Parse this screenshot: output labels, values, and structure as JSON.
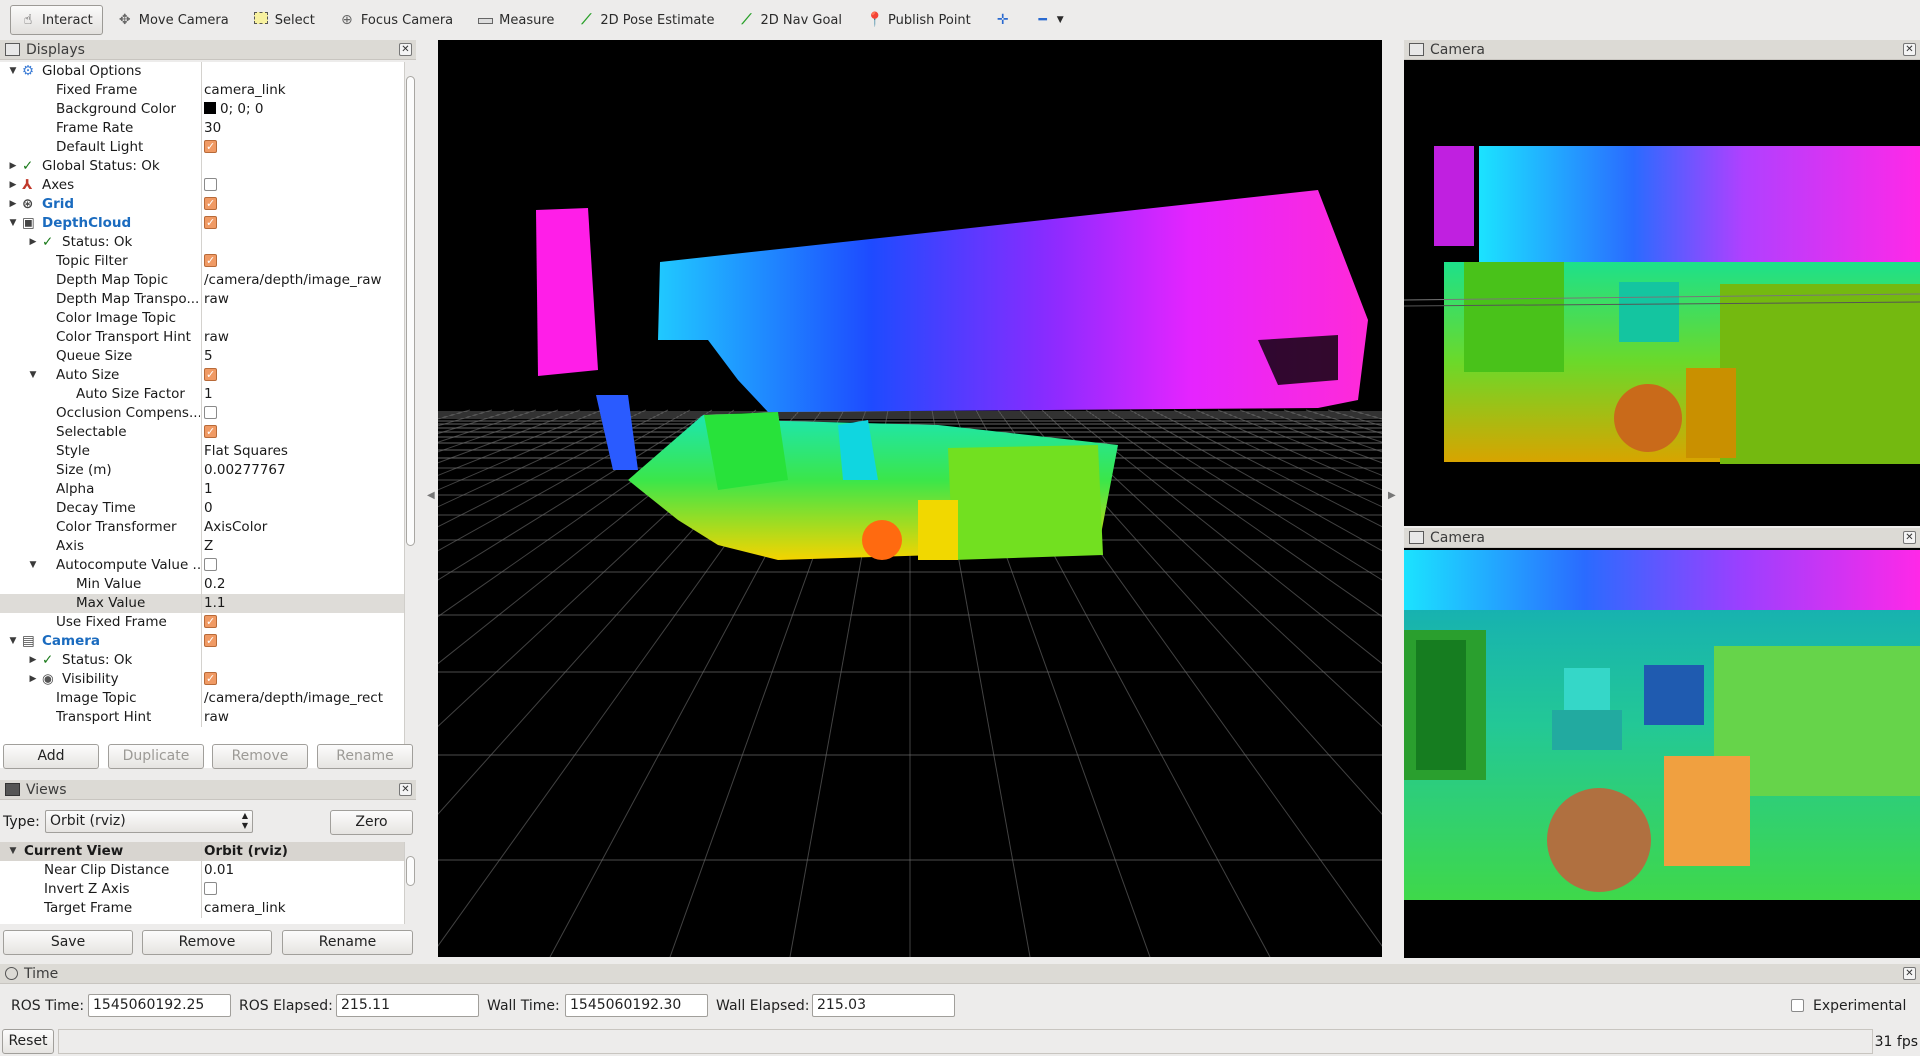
{
  "toolbar": {
    "tools": [
      {
        "label": "Interact",
        "icon": "cursor-icon"
      },
      {
        "label": "Move Camera",
        "icon": "move-icon"
      },
      {
        "label": "Select",
        "icon": "select-box-icon"
      },
      {
        "label": "Focus Camera",
        "icon": "focus-icon"
      },
      {
        "label": "Measure",
        "icon": "ruler-icon"
      },
      {
        "label": "2D Pose Estimate",
        "icon": "pose-arrow-icon"
      },
      {
        "label": "2D Nav Goal",
        "icon": "nav-goal-icon"
      },
      {
        "label": "Publish Point",
        "icon": "map-pin-icon"
      }
    ],
    "active_tool": "Interact"
  },
  "displays": {
    "title": "Displays",
    "rows": [
      {
        "indent": 0,
        "arrow": "open",
        "icon": "gear",
        "name": "Global Options",
        "value": "",
        "style": ""
      },
      {
        "indent": 1,
        "arrow": "",
        "name": "Fixed Frame",
        "value": "camera_link"
      },
      {
        "indent": 1,
        "arrow": "",
        "name": "Background Color",
        "value": "0; 0; 0",
        "swatch": "#000000"
      },
      {
        "indent": 1,
        "arrow": "",
        "name": "Frame Rate",
        "value": "30"
      },
      {
        "indent": 1,
        "arrow": "",
        "name": "Default Light",
        "check": true
      },
      {
        "indent": 0,
        "arrow": "closed",
        "icon": "ok",
        "name": "Global Status: Ok",
        "value": ""
      },
      {
        "indent": 0,
        "arrow": "closed",
        "icon": "axes",
        "name": "Axes",
        "check": false
      },
      {
        "indent": 0,
        "arrow": "closed",
        "icon": "grid",
        "name": "Grid",
        "check": true,
        "style": "blue"
      },
      {
        "indent": 0,
        "arrow": "open",
        "icon": "cloud",
        "name": "DepthCloud",
        "check": true,
        "style": "blue"
      },
      {
        "indent": 1,
        "arrow": "closed",
        "icon": "ok",
        "name": "Status: Ok",
        "value": ""
      },
      {
        "indent": 1,
        "arrow": "",
        "name": "Topic Filter",
        "check": true
      },
      {
        "indent": 1,
        "arrow": "",
        "name": "Depth Map Topic",
        "value": "/camera/depth/image_raw"
      },
      {
        "indent": 1,
        "arrow": "",
        "name": "Depth Map Transpo...",
        "value": "raw"
      },
      {
        "indent": 1,
        "arrow": "",
        "name": "Color Image Topic",
        "value": ""
      },
      {
        "indent": 1,
        "arrow": "",
        "name": "Color Transport Hint",
        "value": "raw"
      },
      {
        "indent": 1,
        "arrow": "",
        "name": "Queue Size",
        "value": "5"
      },
      {
        "indent": 1,
        "arrow": "open",
        "name": "Auto Size",
        "check": true
      },
      {
        "indent": 2,
        "arrow": "",
        "name": "Auto Size Factor",
        "value": "1"
      },
      {
        "indent": 1,
        "arrow": "",
        "name": "Occlusion Compens...",
        "check": false
      },
      {
        "indent": 1,
        "arrow": "",
        "name": "Selectable",
        "check": true
      },
      {
        "indent": 1,
        "arrow": "",
        "name": "Style",
        "value": "Flat Squares"
      },
      {
        "indent": 1,
        "arrow": "",
        "name": "Size (m)",
        "value": "0.00277767"
      },
      {
        "indent": 1,
        "arrow": "",
        "name": "Alpha",
        "value": "1"
      },
      {
        "indent": 1,
        "arrow": "",
        "name": "Decay Time",
        "value": "0"
      },
      {
        "indent": 1,
        "arrow": "",
        "name": "Color Transformer",
        "value": "AxisColor"
      },
      {
        "indent": 1,
        "arrow": "",
        "name": "Axis",
        "value": "Z"
      },
      {
        "indent": 1,
        "arrow": "open",
        "name": "Autocompute Value ...",
        "check": false
      },
      {
        "indent": 2,
        "arrow": "",
        "name": "Min Value",
        "value": "0.2"
      },
      {
        "indent": 2,
        "arrow": "",
        "name": "Max Value",
        "value": "1.1",
        "selected": true
      },
      {
        "indent": 1,
        "arrow": "",
        "name": "Use Fixed Frame",
        "check": true
      },
      {
        "indent": 0,
        "arrow": "open",
        "icon": "camera",
        "name": "Camera",
        "check": true,
        "style": "blue"
      },
      {
        "indent": 1,
        "arrow": "closed",
        "icon": "ok",
        "name": "Status: Ok",
        "value": ""
      },
      {
        "indent": 1,
        "arrow": "closed",
        "icon": "eye",
        "name": "Visibility",
        "check": true
      },
      {
        "indent": 1,
        "arrow": "",
        "name": "Image Topic",
        "value": "/camera/depth/image_rect"
      },
      {
        "indent": 1,
        "arrow": "",
        "name": "Transport Hint",
        "value": "raw"
      }
    ],
    "buttons": {
      "add": "Add",
      "duplicate": "Duplicate",
      "remove": "Remove",
      "rename": "Rename"
    }
  },
  "views": {
    "title": "Views",
    "type_label": "Type:",
    "type_value": "Orbit (rviz)",
    "zero_label": "Zero",
    "header": {
      "name": "Current View",
      "value": "Orbit (rviz)"
    },
    "rows": [
      {
        "name": "Near Clip Distance",
        "value": "0.01"
      },
      {
        "name": "Invert Z Axis",
        "check": false
      },
      {
        "name": "Target Frame",
        "value": "camera_link"
      }
    ],
    "buttons": {
      "save": "Save",
      "remove": "Remove",
      "rename": "Rename"
    }
  },
  "camera_panels": [
    {
      "title": "Camera"
    },
    {
      "title": "Camera"
    }
  ],
  "time": {
    "title": "Time",
    "ros_time_label": "ROS Time:",
    "ros_time": "1545060192.25",
    "ros_elapsed_label": "ROS Elapsed:",
    "ros_elapsed": "215.11",
    "wall_time_label": "Wall Time:",
    "wall_time": "1545060192.30",
    "wall_elapsed_label": "Wall Elapsed:",
    "wall_elapsed": "215.03",
    "experimental_label": "Experimental",
    "experimental": false
  },
  "status": {
    "reset_label": "Reset",
    "fps": "31 fps"
  }
}
